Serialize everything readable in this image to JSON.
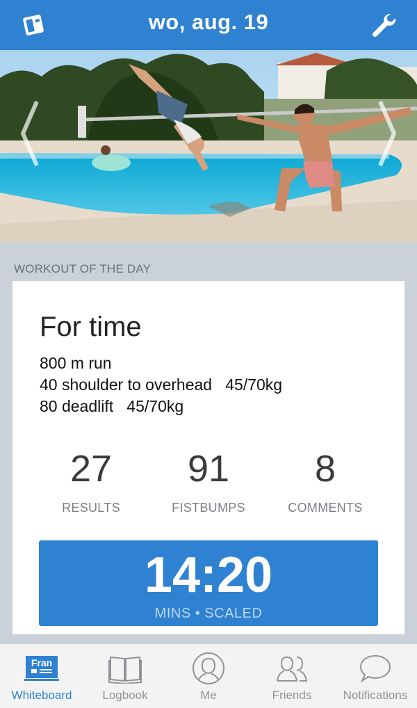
{
  "header": {
    "title": "wo, aug. 19",
    "left_icon": "whiteboard-eraser-icon",
    "right_icon": "wrench-icon",
    "bg_color": "#2e82d1"
  },
  "hero": {
    "prev_icon": "chevron-left-icon",
    "next_icon": "chevron-right-icon"
  },
  "wod": {
    "section_label": "WORKOUT OF THE DAY",
    "title": "For time",
    "lines": [
      "800 m run",
      "40 shoulder to overhead   45/70kg",
      "80 deadlift   45/70kg"
    ],
    "stats": [
      {
        "value": "27",
        "label": "RESULTS"
      },
      {
        "value": "91",
        "label": "FISTBUMPS"
      },
      {
        "value": "8",
        "label": "COMMENTS"
      }
    ],
    "result": {
      "time": "14:20",
      "subtitle": "MINS • SCALED"
    }
  },
  "tabs": [
    {
      "label": "Whiteboard",
      "icon": "whiteboard-fran-icon",
      "badge": "Fran",
      "active": true
    },
    {
      "label": "Logbook",
      "icon": "book-icon",
      "active": false
    },
    {
      "label": "Me",
      "icon": "person-icon",
      "active": false
    },
    {
      "label": "Friends",
      "icon": "friends-icon",
      "active": false
    },
    {
      "label": "Notifications",
      "icon": "speech-bubble-icon",
      "active": false
    }
  ],
  "colors": {
    "accent": "#2e82d1",
    "inactive": "#929399"
  }
}
